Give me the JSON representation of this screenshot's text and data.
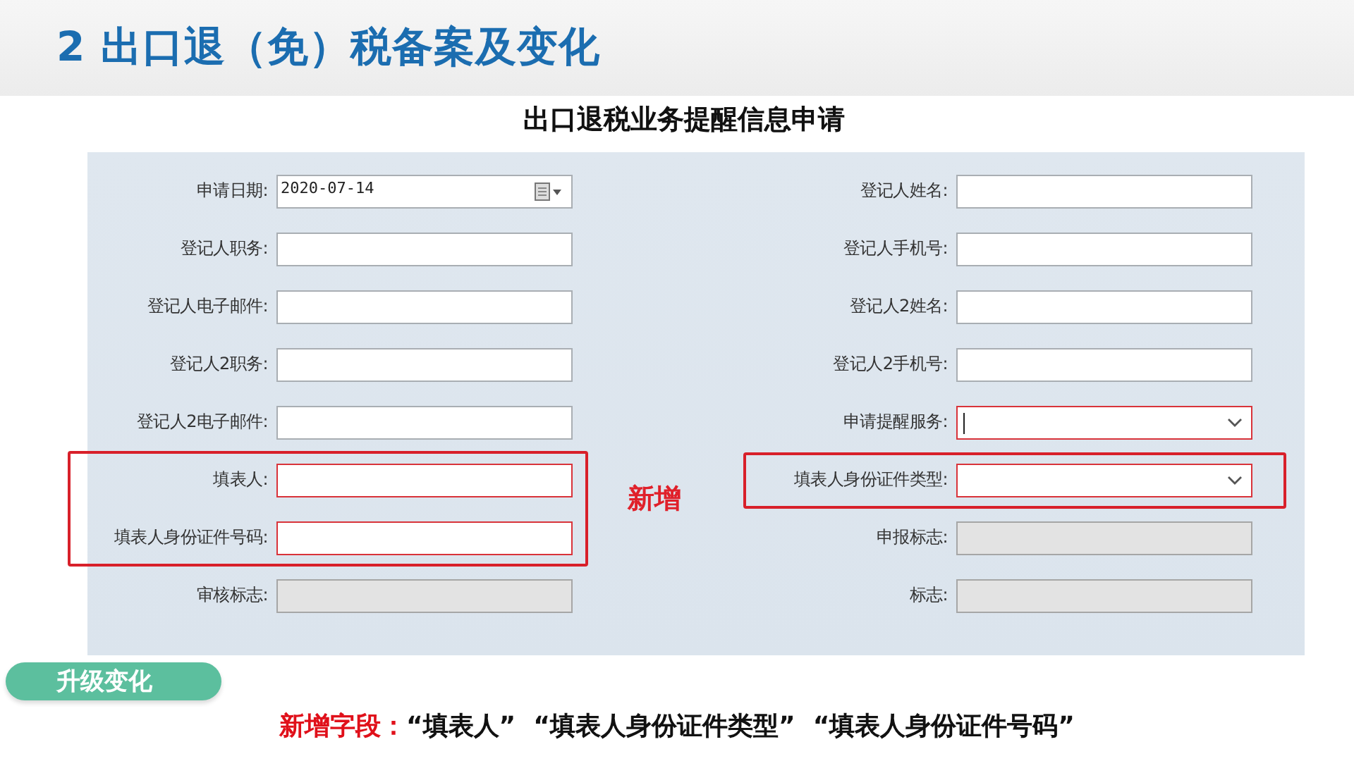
{
  "slide_title": "2 出口退（免）税备案及变化",
  "form": {
    "title": "出口退税业务提醒信息申请",
    "rows": [
      {
        "left": {
          "label": "申请日期:",
          "kind": "date",
          "value": "2020-07-14",
          "required": false,
          "disabled": false
        },
        "right": {
          "label": "登记人姓名:",
          "kind": "text",
          "required": false,
          "disabled": false
        }
      },
      {
        "left": {
          "label": "登记人职务:",
          "kind": "text",
          "required": false,
          "disabled": false
        },
        "right": {
          "label": "登记人手机号:",
          "kind": "text",
          "required": false,
          "disabled": false
        }
      },
      {
        "left": {
          "label": "登记人电子邮件:",
          "kind": "text",
          "required": false,
          "disabled": false
        },
        "right": {
          "label": "登记人2姓名:",
          "kind": "text",
          "required": false,
          "disabled": false
        }
      },
      {
        "left": {
          "label": "登记人2职务:",
          "kind": "text",
          "required": false,
          "disabled": false
        },
        "right": {
          "label": "登记人2手机号:",
          "kind": "text",
          "required": false,
          "disabled": false
        }
      },
      {
        "left": {
          "label": "登记人2电子邮件:",
          "kind": "text",
          "required": false,
          "disabled": false
        },
        "right": {
          "label": "申请提醒服务:",
          "kind": "select",
          "required": true,
          "disabled": false,
          "focused": true
        }
      },
      {
        "left": {
          "label": "填表人:",
          "kind": "text",
          "required": true,
          "disabled": false,
          "new": true
        },
        "right": {
          "label": "填表人身份证件类型:",
          "kind": "select",
          "required": true,
          "disabled": false,
          "new": true
        }
      },
      {
        "left": {
          "label": "填表人身份证件号码:",
          "kind": "text",
          "required": true,
          "disabled": false,
          "new": true
        },
        "right": {
          "label": "申报标志:",
          "kind": "text",
          "required": false,
          "disabled": true
        }
      },
      {
        "left": {
          "label": "审核标志:",
          "kind": "text",
          "required": false,
          "disabled": true
        },
        "right": {
          "label": "标志:",
          "kind": "text",
          "required": false,
          "disabled": true
        }
      }
    ],
    "new_label": "新增"
  },
  "badge": "升级变化",
  "note": {
    "label": "新增字段：",
    "text": "“填表人”  “填表人身份证件类型”  “填表人身份证件号码”"
  }
}
